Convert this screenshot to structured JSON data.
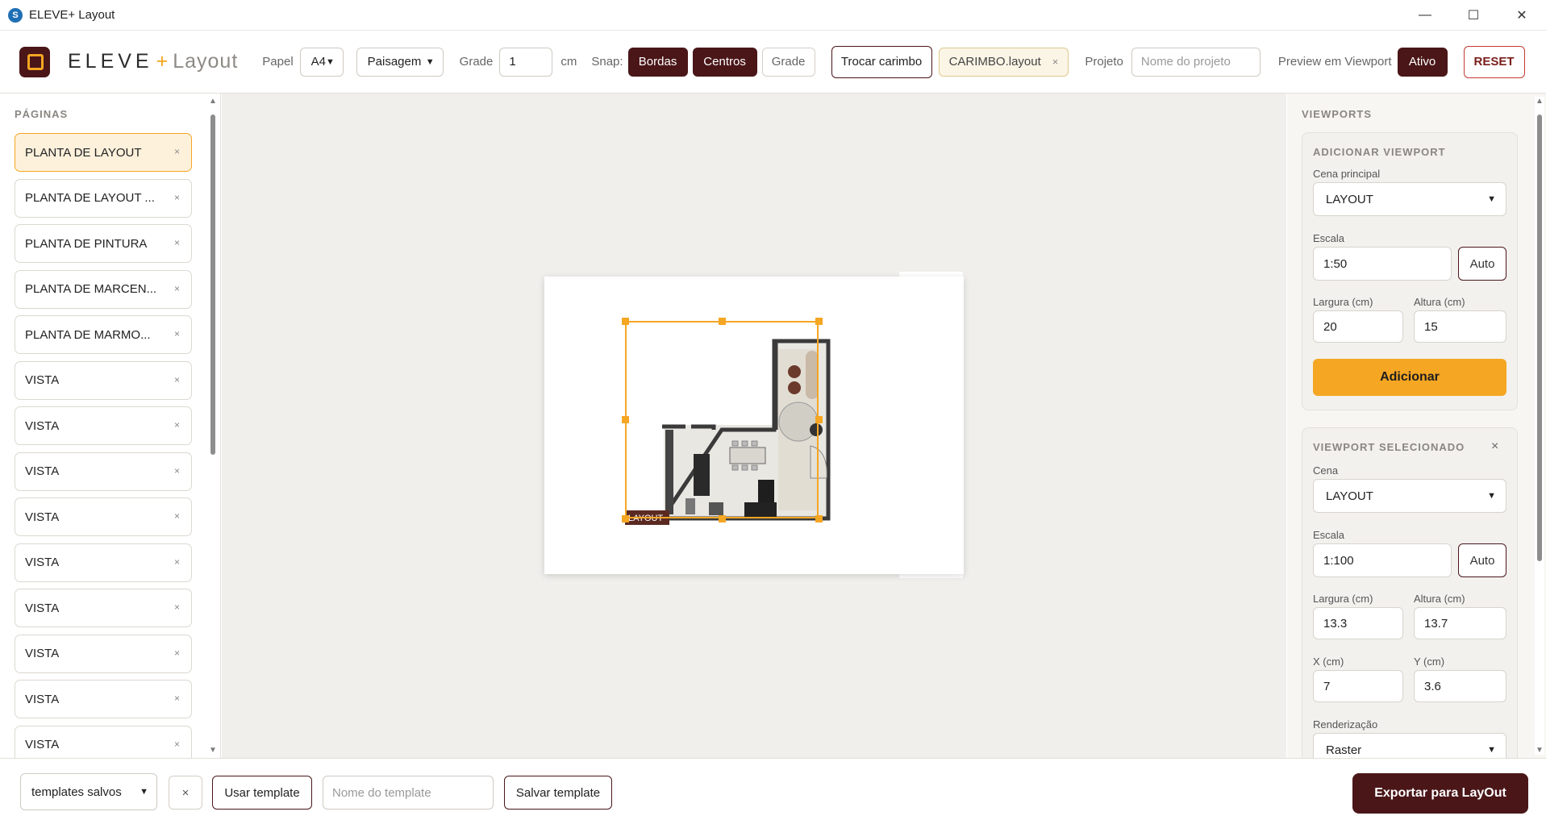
{
  "window": {
    "title": "ELEVE+ Layout",
    "minimize": "—",
    "maximize": "☐",
    "close": "✕"
  },
  "brand": {
    "name": "ELEVE",
    "plus": "+",
    "sub": "Layout"
  },
  "toolbar": {
    "paper_label": "Papel",
    "paper_value": "A4",
    "orientation_value": "Paisagem",
    "grid_label": "Grade",
    "grid_value": "1",
    "grid_unit": "cm",
    "snap_label": "Snap:",
    "snap_borders": "Bordas",
    "snap_centers": "Centros",
    "snap_grid": "Grade",
    "stamp_button": "Trocar carimbo",
    "stamp_file": "CARIMBO.layout",
    "project_label": "Projeto",
    "project_placeholder": "Nome do projeto",
    "preview_label": "Preview em Viewport",
    "preview_value": "Ativo",
    "reset": "RESET"
  },
  "sidebar": {
    "title": "PÁGINAS",
    "pages": [
      {
        "label": "PLANTA DE LAYOUT",
        "active": true
      },
      {
        "label": "PLANTA DE LAYOUT ..."
      },
      {
        "label": "PLANTA DE PINTURA"
      },
      {
        "label": "PLANTA DE MARCEN..."
      },
      {
        "label": "PLANTA DE MARMO..."
      },
      {
        "label": "VISTA"
      },
      {
        "label": "VISTA"
      },
      {
        "label": "VISTA"
      },
      {
        "label": "VISTA"
      },
      {
        "label": "VISTA"
      },
      {
        "label": "VISTA"
      },
      {
        "label": "VISTA"
      },
      {
        "label": "VISTA"
      },
      {
        "label": "VISTA"
      }
    ],
    "remove_glyph": "×"
  },
  "canvas": {
    "viewport_label": "LAYOUT"
  },
  "viewports": {
    "title": "VIEWPORTS",
    "add": {
      "title": "ADICIONAR VIEWPORT",
      "scene_label": "Cena principal",
      "scene_value": "LAYOUT",
      "scale_label": "Escala",
      "scale_value": "1:50",
      "auto": "Auto",
      "width_label": "Largura (cm)",
      "width_value": "20",
      "height_label": "Altura (cm)",
      "height_value": "15",
      "add_button": "Adicionar"
    },
    "selected": {
      "title": "VIEWPORT SELECIONADO",
      "close": "×",
      "scene_label": "Cena",
      "scene_value": "LAYOUT",
      "scale_label": "Escala",
      "scale_value": "1:100",
      "auto": "Auto",
      "width_label": "Largura (cm)",
      "width_value": "13.3",
      "height_label": "Altura (cm)",
      "height_value": "13.7",
      "x_label": "X (cm)",
      "x_value": "7",
      "y_label": "Y (cm)",
      "y_value": "3.6",
      "render_label": "Renderização",
      "render_value": "Raster"
    }
  },
  "bottom": {
    "templates_value": "templates salvos",
    "clear": "×",
    "use_template": "Usar template",
    "template_name_placeholder": "Nome do template",
    "save_template": "Salvar template",
    "export": "Exportar para LayOut"
  },
  "colors": {
    "accent": "#f5a623",
    "brand_dark": "#4a1618",
    "canvas_bg": "#f0efec"
  },
  "icons": [
    "sketchup-app-icon",
    "chevron-down-icon",
    "close-icon",
    "scroll-up-icon",
    "scroll-down-icon"
  ]
}
